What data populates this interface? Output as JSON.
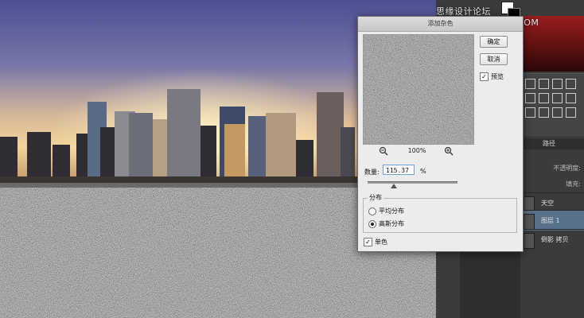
{
  "watermark": "思缘设计论坛 WWW.MISSYUAN.COM",
  "dialog": {
    "title": "添加杂色",
    "ok_label": "确定",
    "cancel_label": "取消",
    "preview_label": "预览",
    "preview_checked": true,
    "zoom_level": "100%",
    "amount_label": "数量:",
    "amount_value": "115.37",
    "amount_unit": "%",
    "distribution_title": "分布",
    "uniform_label": "平均分布",
    "gaussian_label": "高斯分布",
    "selected_distribution": "gaussian",
    "monochromatic_label": "单色",
    "monochromatic_checked": true
  },
  "layers_panel": {
    "tab_label": "路径",
    "opacity_label": "不透明度:",
    "fill_label": "填充:",
    "layers": [
      {
        "name": "天空"
      },
      {
        "name": "图层 1",
        "selected": true
      },
      {
        "name": "倒影 拷贝"
      }
    ]
  },
  "colors": {
    "selected_layer": "#59708a",
    "dialog_bg": "#ececec",
    "panel_bg": "#3b3b3b"
  }
}
